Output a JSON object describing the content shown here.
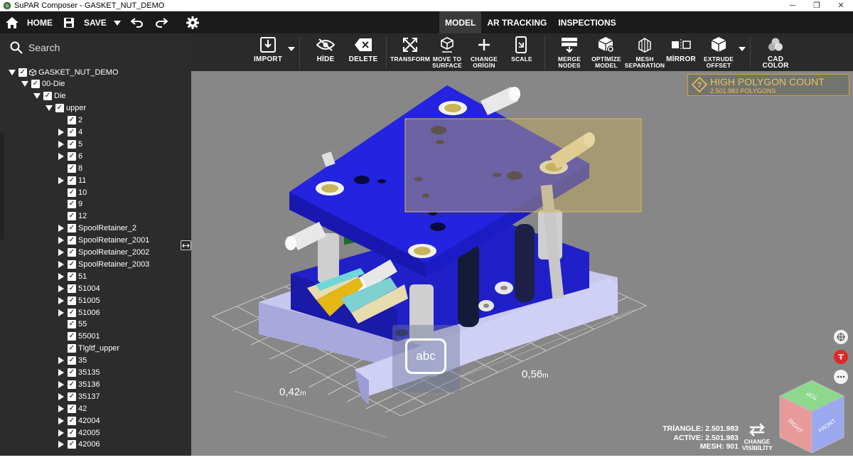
{
  "window": {
    "title": "SuPAR Composer - GASKET_NUT_DEMO",
    "minimize": "─",
    "restore": "❐",
    "close": "✕"
  },
  "topbar": {
    "home_label": "HOME",
    "save_label": "SAVE",
    "tabs": [
      {
        "label": "MODEL",
        "active": true
      },
      {
        "label": "AR TRACKING",
        "active": false
      },
      {
        "label": "INSPECTIONS",
        "active": false
      }
    ]
  },
  "sidebar": {
    "search_label": "Search",
    "tree": [
      {
        "label": "GASKET_NUT_DEMO",
        "level": 0,
        "arrow": "expanded",
        "cube": true
      },
      {
        "label": "00-Die",
        "level": 1,
        "arrow": "expanded"
      },
      {
        "label": "Die",
        "level": 2,
        "arrow": "expanded"
      },
      {
        "label": "upper",
        "level": 3,
        "arrow": "expanded"
      },
      {
        "label": "2",
        "level": 4,
        "arrow": "none"
      },
      {
        "label": "4",
        "level": 4,
        "arrow": "collapsed"
      },
      {
        "label": "5",
        "level": 4,
        "arrow": "collapsed"
      },
      {
        "label": "6",
        "level": 4,
        "arrow": "collapsed"
      },
      {
        "label": "8",
        "level": 4,
        "arrow": "none"
      },
      {
        "label": "11",
        "level": 4,
        "arrow": "collapsed"
      },
      {
        "label": "10",
        "level": 4,
        "arrow": "none"
      },
      {
        "label": "9",
        "level": 4,
        "arrow": "none"
      },
      {
        "label": "12",
        "level": 4,
        "arrow": "none"
      },
      {
        "label": "SpoolRetainer_2",
        "level": 4,
        "arrow": "collapsed"
      },
      {
        "label": "SpoolRetainer_2001",
        "level": 4,
        "arrow": "collapsed"
      },
      {
        "label": "SpoolRetainer_2002",
        "level": 4,
        "arrow": "collapsed"
      },
      {
        "label": "SpoolRetainer_2003",
        "level": 4,
        "arrow": "collapsed"
      },
      {
        "label": "51",
        "level": 4,
        "arrow": "collapsed"
      },
      {
        "label": "51004",
        "level": 4,
        "arrow": "collapsed"
      },
      {
        "label": "51005",
        "level": 4,
        "arrow": "collapsed"
      },
      {
        "label": "51006",
        "level": 4,
        "arrow": "collapsed"
      },
      {
        "label": "55",
        "level": 4,
        "arrow": "none"
      },
      {
        "label": "55001",
        "level": 4,
        "arrow": "none"
      },
      {
        "label": "Tlgltf_upper",
        "level": 4,
        "arrow": "none"
      },
      {
        "label": "35",
        "level": 4,
        "arrow": "collapsed"
      },
      {
        "label": "35135",
        "level": 4,
        "arrow": "collapsed"
      },
      {
        "label": "35136",
        "level": 4,
        "arrow": "collapsed"
      },
      {
        "label": "35137",
        "level": 4,
        "arrow": "collapsed"
      },
      {
        "label": "42",
        "level": 4,
        "arrow": "collapsed"
      },
      {
        "label": "42004",
        "level": 4,
        "arrow": "collapsed"
      },
      {
        "label": "42005",
        "level": 4,
        "arrow": "collapsed"
      },
      {
        "label": "42006",
        "level": 4,
        "arrow": "collapsed"
      }
    ]
  },
  "ribbon": {
    "import": "IMPORT",
    "hide": "HİDE",
    "delete": "DELETE",
    "transform": "TRANSFORM",
    "move_to_surface": [
      "MOVE TO",
      "SURFACE"
    ],
    "change_origin": [
      "CHANGE",
      "ORİGİN"
    ],
    "scale": "SCALE",
    "merge_nodes": [
      "MERGE",
      "NODES"
    ],
    "optimize_model": [
      "OPTİMİZE",
      "MODEL"
    ],
    "mesh_separation": [
      "MESH",
      "SEPARATİON"
    ],
    "mirror": "MİRROR",
    "extrude_offset": [
      "EXTRUDE",
      "OFFSET"
    ],
    "cad_color": "CAD COLOR"
  },
  "viewport": {
    "warning_title": "HIGH POLYGON COUNT",
    "warning_sub": "2.501.983 POLYGONS",
    "dim_a_value": "0,42",
    "dim_a_unit": "m",
    "dim_b_value": "0,56",
    "dim_b_unit": "m",
    "keyboard_key": "abc",
    "stats": {
      "triangle": "TRİANGLE: 2.501.983",
      "active": "ACTİVE: 2.501.983",
      "mesh": "MESH: 901"
    },
    "change_visibility": [
      "CHANGE",
      "VİSİBİLİTY"
    ],
    "view_cube": {
      "top": "TOP",
      "right": "RIGHT",
      "front": "FRONT"
    },
    "colors": {
      "background": "#878787",
      "die_plate": "#1f1fd0",
      "selection": "#c8b05a",
      "warning": "#e3c25a",
      "red_button": "#e0282a"
    }
  }
}
